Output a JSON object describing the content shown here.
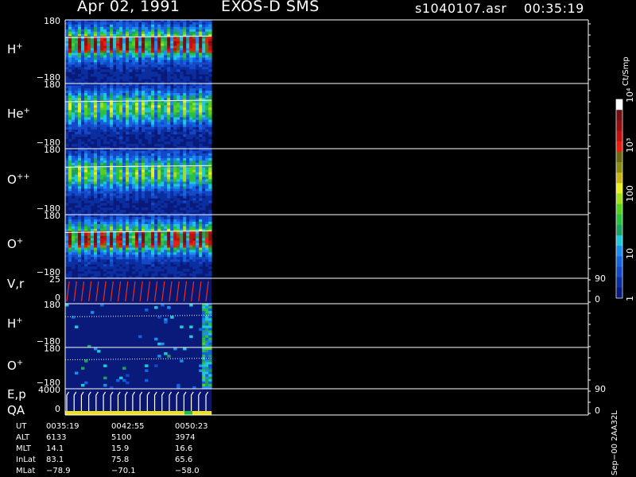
{
  "header": {
    "date": "Apr 02, 1991",
    "instrument": "EXOS-D SMS",
    "file": "s1040107.asr",
    "time": "00:35:19"
  },
  "colorbar": {
    "unit": "Ct/Smp",
    "ticks": [
      "1",
      "10",
      "100",
      "10³",
      "10⁴"
    ],
    "colors": [
      "#0a1a7a",
      "#0b2fa0",
      "#1448c8",
      "#1464e0",
      "#1e8cf0",
      "#20c8d8",
      "#20a060",
      "#2cc040",
      "#58d020",
      "#a0e020",
      "#e8f020",
      "#c8b418",
      "#8c8c14",
      "#6a6a10",
      "#e82010",
      "#c01010",
      "#901010",
      "#701010",
      "#ffffff"
    ]
  },
  "panels": [
    {
      "label": "H",
      "sup": "+",
      "top_tick": "180",
      "bottom_tick": "−180"
    },
    {
      "label": "He",
      "sup": "+",
      "top_tick": "180",
      "bottom_tick": "−180"
    },
    {
      "label": "O",
      "sup": "++",
      "top_tick": "180",
      "bottom_tick": "−180"
    },
    {
      "label": "O",
      "sup": "+",
      "top_tick": "180",
      "bottom_tick": "−180"
    },
    {
      "label": "V,r",
      "sup": "",
      "top_tick": "25",
      "bottom_tick": "0",
      "right_top": "90",
      "right_bottom": "0"
    },
    {
      "label": "H",
      "sup": "+",
      "top_tick": "180",
      "bottom_tick": "−180"
    },
    {
      "label": "O",
      "sup": "+",
      "top_tick": "180",
      "bottom_tick": "−180"
    },
    {
      "label": "E,p",
      "label2": "QA",
      "sup": "",
      "top_tick": "4000",
      "bottom_tick": "0",
      "right_top": "90",
      "right_bottom": "0"
    }
  ],
  "orbit_table": {
    "rows": [
      {
        "name": "UT",
        "values": [
          "0035:19",
          "0042:55",
          "0050:23"
        ]
      },
      {
        "name": "ALT",
        "values": [
          "6133",
          "5100",
          "3974"
        ]
      },
      {
        "name": "MLT",
        "values": [
          "14.1",
          "15.9",
          "16.6"
        ]
      },
      {
        "name": "InLat",
        "values": [
          "83.1",
          "75.8",
          "65.6"
        ]
      },
      {
        "name": "MLat",
        "values": [
          "−78.9",
          "−70.1",
          "−58.0"
        ]
      }
    ]
  },
  "side_note": "Sep−00  2AA32L",
  "chart_data": {
    "type": "heatmap",
    "title": "Apr 02, 1991   EXOS-D SMS",
    "x": [
      "0035:19",
      "0042:55",
      "0050:23"
    ],
    "data_end_fraction": 0.28,
    "spin_count": 18,
    "series": [
      {
        "name": "H+",
        "ylim": [
          -180,
          180
        ]
      },
      {
        "name": "He+",
        "ylim": [
          -180,
          180
        ]
      },
      {
        "name": "O++",
        "ylim": [
          -180,
          180
        ]
      },
      {
        "name": "O+",
        "ylim": [
          -180,
          180
        ]
      },
      {
        "name": "V,r",
        "ylim": [
          0,
          25
        ],
        "y2lim": [
          0,
          90
        ]
      },
      {
        "name": "H+",
        "ylim": [
          -180,
          180
        ]
      },
      {
        "name": "O+",
        "ylim": [
          -180,
          180
        ]
      },
      {
        "name": "E,p",
        "ylim": [
          0,
          4000
        ],
        "y2lim": [
          0,
          90
        ]
      }
    ]
  }
}
